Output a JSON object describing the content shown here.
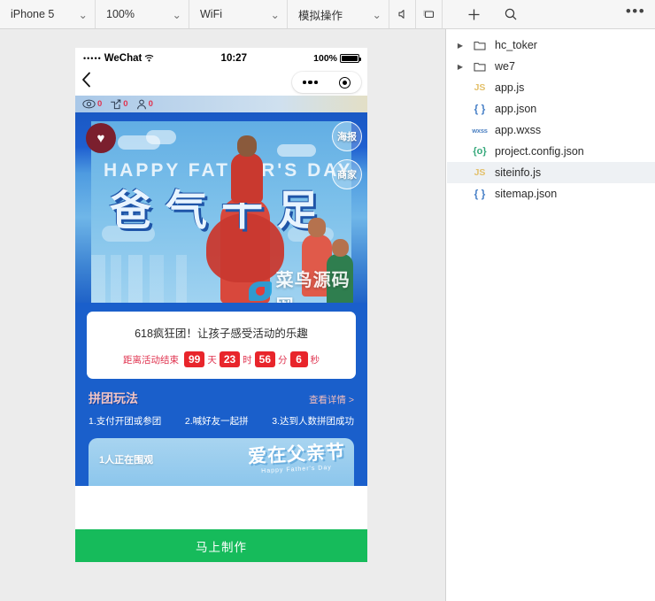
{
  "toolbar": {
    "device": "iPhone 5",
    "zoom": "100%",
    "network": "WiFi",
    "mode": "模拟操作",
    "chevron": "⌄",
    "icons": {
      "mute": "mute-icon",
      "window": "window-icon",
      "add": "+",
      "search": "search-icon",
      "more": "•••"
    }
  },
  "simulator": {
    "status_bar": {
      "signal_dots": "•••••",
      "carrier": "WeChat",
      "wifi": "wifi-icon",
      "time": "10:27",
      "battery_percent": "100%"
    },
    "nav": {
      "back": "‹",
      "capsule_menu": "menu-dots",
      "capsule_target": "target-icon"
    },
    "stats": [
      {
        "icon": "eye-icon",
        "value": "0"
      },
      {
        "icon": "share-icon",
        "value": "0"
      },
      {
        "icon": "person-icon",
        "value": "0"
      }
    ],
    "hero": {
      "english_title": "HAPPY FATHER'S DAY",
      "chinese_title": "爸气十足",
      "badge": "♥",
      "side_buttons": [
        {
          "label": "海报",
          "name": "poster-button"
        },
        {
          "label": "商家",
          "name": "merchant-button"
        }
      ],
      "watermark": "菜鸟源码网"
    },
    "promo_card": {
      "title": "618疯狂团！让孩子感受活动的乐趣",
      "countdown_label": "距离活动结束",
      "days": "99",
      "days_unit": "天",
      "hours": "23",
      "hours_unit": "时",
      "minutes": "56",
      "minutes_unit": "分",
      "seconds": "6",
      "seconds_unit": "秒"
    },
    "play_section": {
      "title": "拼团玩法",
      "more_link": "查看详情 >",
      "steps": [
        "1.支付开团或参团",
        "2.喊好友一起拼",
        "3.达到人数拼团成功"
      ]
    },
    "watch_card": {
      "count_text": "1人正在围观",
      "art_cn": "爱在父亲节",
      "art_en": "Happy Father's Day"
    },
    "cta_button": "马上制作"
  },
  "explorer": {
    "items": [
      {
        "name": "hc_toker",
        "type": "folder",
        "twisty": "▶",
        "selected": false
      },
      {
        "name": "we7",
        "type": "folder",
        "twisty": "▶",
        "selected": false
      },
      {
        "name": "app.js",
        "type": "js",
        "icon": "JS",
        "selected": false
      },
      {
        "name": "app.json",
        "type": "json",
        "icon": "{ }",
        "selected": false
      },
      {
        "name": "app.wxss",
        "type": "wxss",
        "icon": "wxss",
        "selected": false
      },
      {
        "name": "project.config.json",
        "type": "cfg",
        "icon": "{o}",
        "selected": false
      },
      {
        "name": "siteinfo.js",
        "type": "js",
        "icon": "JS",
        "selected": true
      },
      {
        "name": "sitemap.json",
        "type": "json",
        "icon": "{ }",
        "selected": false
      }
    ]
  },
  "colors": {
    "accent_green": "#16bb5b",
    "accent_red": "#e8252b",
    "blue_bg": "#1a5fcb",
    "toolbar_bg": "#f6f6f6"
  }
}
